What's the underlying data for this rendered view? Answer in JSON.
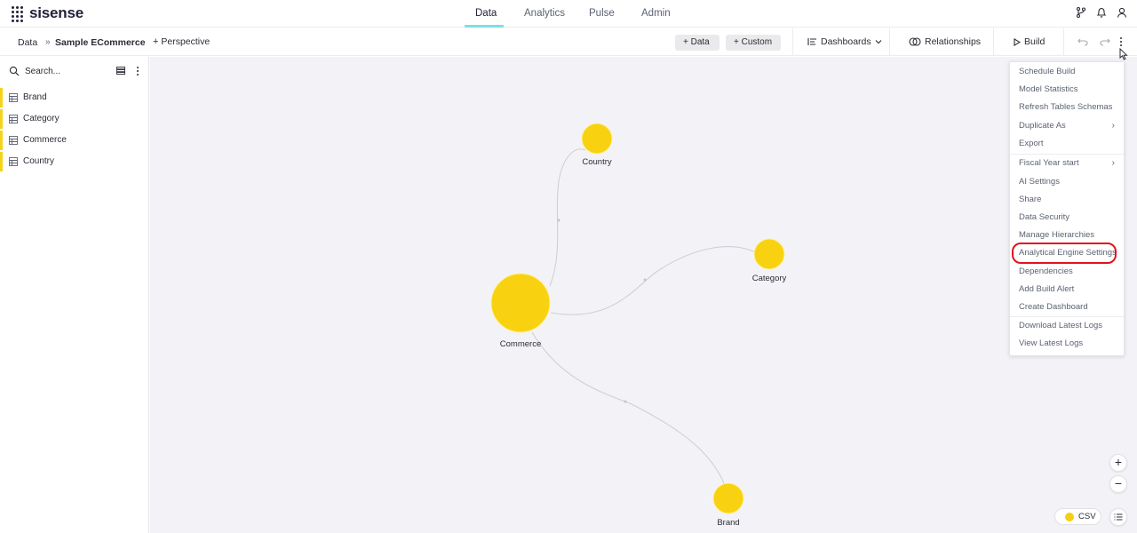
{
  "brand": {
    "name": "sisense"
  },
  "nav": {
    "tabs": [
      {
        "label": "Data",
        "active": true
      },
      {
        "label": "Analytics",
        "active": false
      },
      {
        "label": "Pulse",
        "active": false
      },
      {
        "label": "Admin",
        "active": false
      }
    ]
  },
  "toolbar": {
    "breadcrumb": {
      "root": "Data",
      "separator": "»",
      "model": "Sample ECommerce"
    },
    "perspective_label": "Perspective",
    "add_data_label": "Data",
    "add_custom_label": "Custom",
    "dashboards_label": "Dashboards",
    "relationships_label": "Relationships",
    "build_label": "Build"
  },
  "left_panel": {
    "search_placeholder": "Search...",
    "tables": [
      {
        "label": "Brand"
      },
      {
        "label": "Category"
      },
      {
        "label": "Commerce"
      },
      {
        "label": "Country"
      }
    ]
  },
  "canvas": {
    "nodes": [
      {
        "label": "Country"
      },
      {
        "label": "Category"
      },
      {
        "label": "Commerce"
      },
      {
        "label": "Brand"
      }
    ],
    "node_color": "#f8d210",
    "edge_color": "#cfcfd8",
    "legend_label": "CSV"
  },
  "menu": {
    "items": [
      {
        "label": "Schedule Build",
        "submenu": false
      },
      {
        "label": "Model Statistics",
        "submenu": false
      },
      {
        "label": "Refresh Tables Schemas",
        "submenu": false
      },
      {
        "label": "Duplicate As",
        "submenu": true
      },
      {
        "label": "Export",
        "submenu": false
      },
      {
        "label": "Fiscal Year start",
        "submenu": true
      },
      {
        "label": "AI Settings",
        "submenu": false
      },
      {
        "label": "Share",
        "submenu": false
      },
      {
        "label": "Data Security",
        "submenu": false
      },
      {
        "label": "Manage Hierarchies",
        "submenu": false
      },
      {
        "label": "Analytical Engine Settings",
        "submenu": false,
        "highlighted": true
      },
      {
        "label": "Dependencies",
        "submenu": false
      },
      {
        "label": "Add Build Alert",
        "submenu": false
      },
      {
        "label": "Create Dashboard",
        "submenu": false
      },
      {
        "label": "Download Latest Logs",
        "submenu": false
      },
      {
        "label": "View Latest Logs",
        "submenu": false
      }
    ],
    "highlight_color": "#e1141e"
  },
  "nav_accent": "#7be0e4",
  "table_accent": "#f5d31b"
}
